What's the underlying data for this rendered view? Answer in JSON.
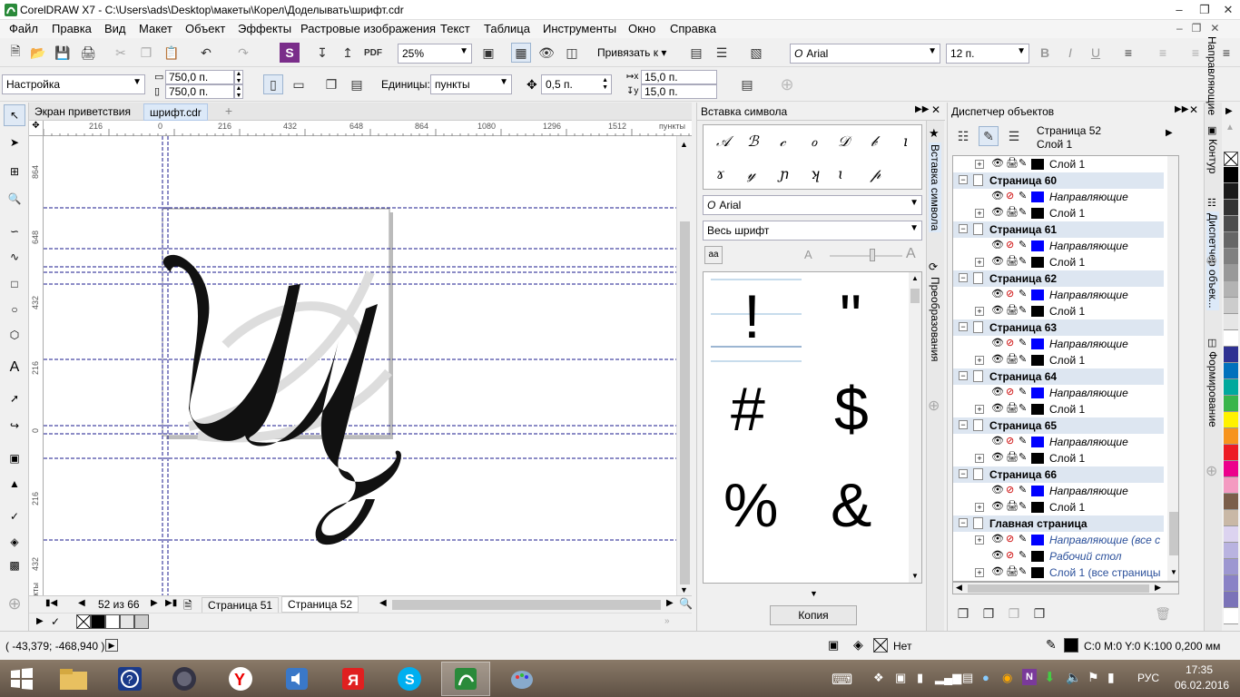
{
  "window": {
    "title": "CorelDRAW X7 - C:\\Users\\ads\\Desktop\\макеты\\Корел\\Доделывать\\шрифт.cdr"
  },
  "menu": {
    "items": [
      "Файл",
      "Правка",
      "Вид",
      "Макет",
      "Объект",
      "Эффекты",
      "Растровые изображения",
      "Текст",
      "Таблица",
      "Инструменты",
      "Окно",
      "Справка"
    ]
  },
  "standard_toolbar": {
    "zoom": "25%",
    "snap_label": "Привязать к",
    "font": "Arial",
    "font_size": "12 п."
  },
  "property_bar": {
    "preset": "Настройка",
    "width": "750,0 п.",
    "height": "750,0 п.",
    "units_label": "Единицы:",
    "units": "пункты",
    "nudge": "0,5 п.",
    "dup_x": "15,0 п.",
    "dup_y": "15,0 п."
  },
  "doc_tabs": [
    "Экран приветствия",
    "шрифт.cdr"
  ],
  "ruler_h": {
    "labels": [
      "216",
      "0",
      "216",
      "432",
      "648",
      "864",
      "1080",
      "1296",
      "1512",
      "пункты"
    ]
  },
  "ruler_v": {
    "labels": [
      "864",
      "648",
      "432",
      "216",
      "0",
      "216",
      "432",
      "пункты"
    ]
  },
  "page_nav": {
    "counter": "52 из 66",
    "tabs": [
      "Страница 51",
      "Страница 52"
    ]
  },
  "symbol_panel": {
    "title": "Вставка символа",
    "font": "Arial",
    "subset": "Весь шрифт",
    "script_glyphs": [
      "𝒜",
      "ℬ",
      "𝒸",
      "ℴ",
      "𝒟",
      "𝒷",
      "ı",
      "ɤ",
      "𝓎",
      "ɲ",
      "ʞ",
      "ɩ",
      "𝓅"
    ],
    "glyphs": [
      "!",
      "\"",
      "#",
      "$",
      "%",
      "&"
    ],
    "copy_button": "Копия",
    "side_tabs": [
      "Вставка символа",
      "Преобразования"
    ]
  },
  "object_manager": {
    "title": "Диспетчер объектов",
    "current_page": "Страница 52",
    "current_layer": "Слой 1",
    "rows": [
      {
        "type": "layer",
        "label": "Слой 1",
        "color": "#000000"
      },
      {
        "type": "page",
        "label": "Страница 60"
      },
      {
        "type": "guides",
        "label": "Направляющие",
        "color": "#0000ff"
      },
      {
        "type": "layer",
        "label": "Слой 1",
        "color": "#000000"
      },
      {
        "type": "page",
        "label": "Страница 61"
      },
      {
        "type": "guides",
        "label": "Направляющие",
        "color": "#0000ff"
      },
      {
        "type": "layer",
        "label": "Слой 1",
        "color": "#000000"
      },
      {
        "type": "page",
        "label": "Страница 62"
      },
      {
        "type": "guides",
        "label": "Направляющие",
        "color": "#0000ff"
      },
      {
        "type": "layer",
        "label": "Слой 1",
        "color": "#000000"
      },
      {
        "type": "page",
        "label": "Страница 63"
      },
      {
        "type": "guides",
        "label": "Направляющие",
        "color": "#0000ff"
      },
      {
        "type": "layer",
        "label": "Слой 1",
        "color": "#000000"
      },
      {
        "type": "page",
        "label": "Страница 64"
      },
      {
        "type": "guides",
        "label": "Направляющие",
        "color": "#0000ff"
      },
      {
        "type": "layer",
        "label": "Слой 1",
        "color": "#000000"
      },
      {
        "type": "page",
        "label": "Страница 65"
      },
      {
        "type": "guides",
        "label": "Направляющие",
        "color": "#0000ff"
      },
      {
        "type": "layer",
        "label": "Слой 1",
        "color": "#000000"
      },
      {
        "type": "page",
        "label": "Страница 66"
      },
      {
        "type": "guides",
        "label": "Направляющие",
        "color": "#0000ff"
      },
      {
        "type": "layer",
        "label": "Слой 1",
        "color": "#000000"
      },
      {
        "type": "page",
        "label": "Главная страница"
      },
      {
        "type": "master-guides",
        "label": "Направляющие (все с",
        "color": "#0000ff"
      },
      {
        "type": "master-desktop",
        "label": "Рабочий стол",
        "color": "#000000"
      },
      {
        "type": "master-layer",
        "label": "Слой 1 (все страницы",
        "color": "#000000"
      }
    ],
    "side_tabs": [
      "Контур",
      "Диспетчер объек...",
      "Формирование",
      "Направляющие"
    ]
  },
  "right_palette": {
    "colors": [
      "#000000",
      "#1a1a1a",
      "#333333",
      "#4d4d4d",
      "#666666",
      "#808080",
      "#999999",
      "#b3b3b3",
      "#cccccc",
      "#e6e6e6",
      "#ffffff",
      "#2e3192",
      "#0071bc",
      "#00a99d",
      "#39b54a",
      "#fff200",
      "#f7941d",
      "#ed1c24",
      "#ec008c",
      "#f49ac1",
      "#7b5e4a",
      "#c9b8a6",
      "#dcd3f0",
      "#b9b3e0",
      "#9d97d1",
      "#8a82c6",
      "#7b73b8",
      "#ffffff"
    ]
  },
  "status": {
    "coords": "( -43,379; -468,940 )",
    "fill_label": "Нет",
    "outline": "C:0 M:0 Y:0 K:100  0,200 мм"
  },
  "taskbar": {
    "time": "17:35",
    "date": "06.02.2016",
    "lang": "РУС"
  },
  "colors": {
    "guide": "#1a1a8c",
    "page_row_bg": "#dde6f1",
    "guide_swatch": "#0000ff",
    "accent": "#b7d7f0"
  }
}
